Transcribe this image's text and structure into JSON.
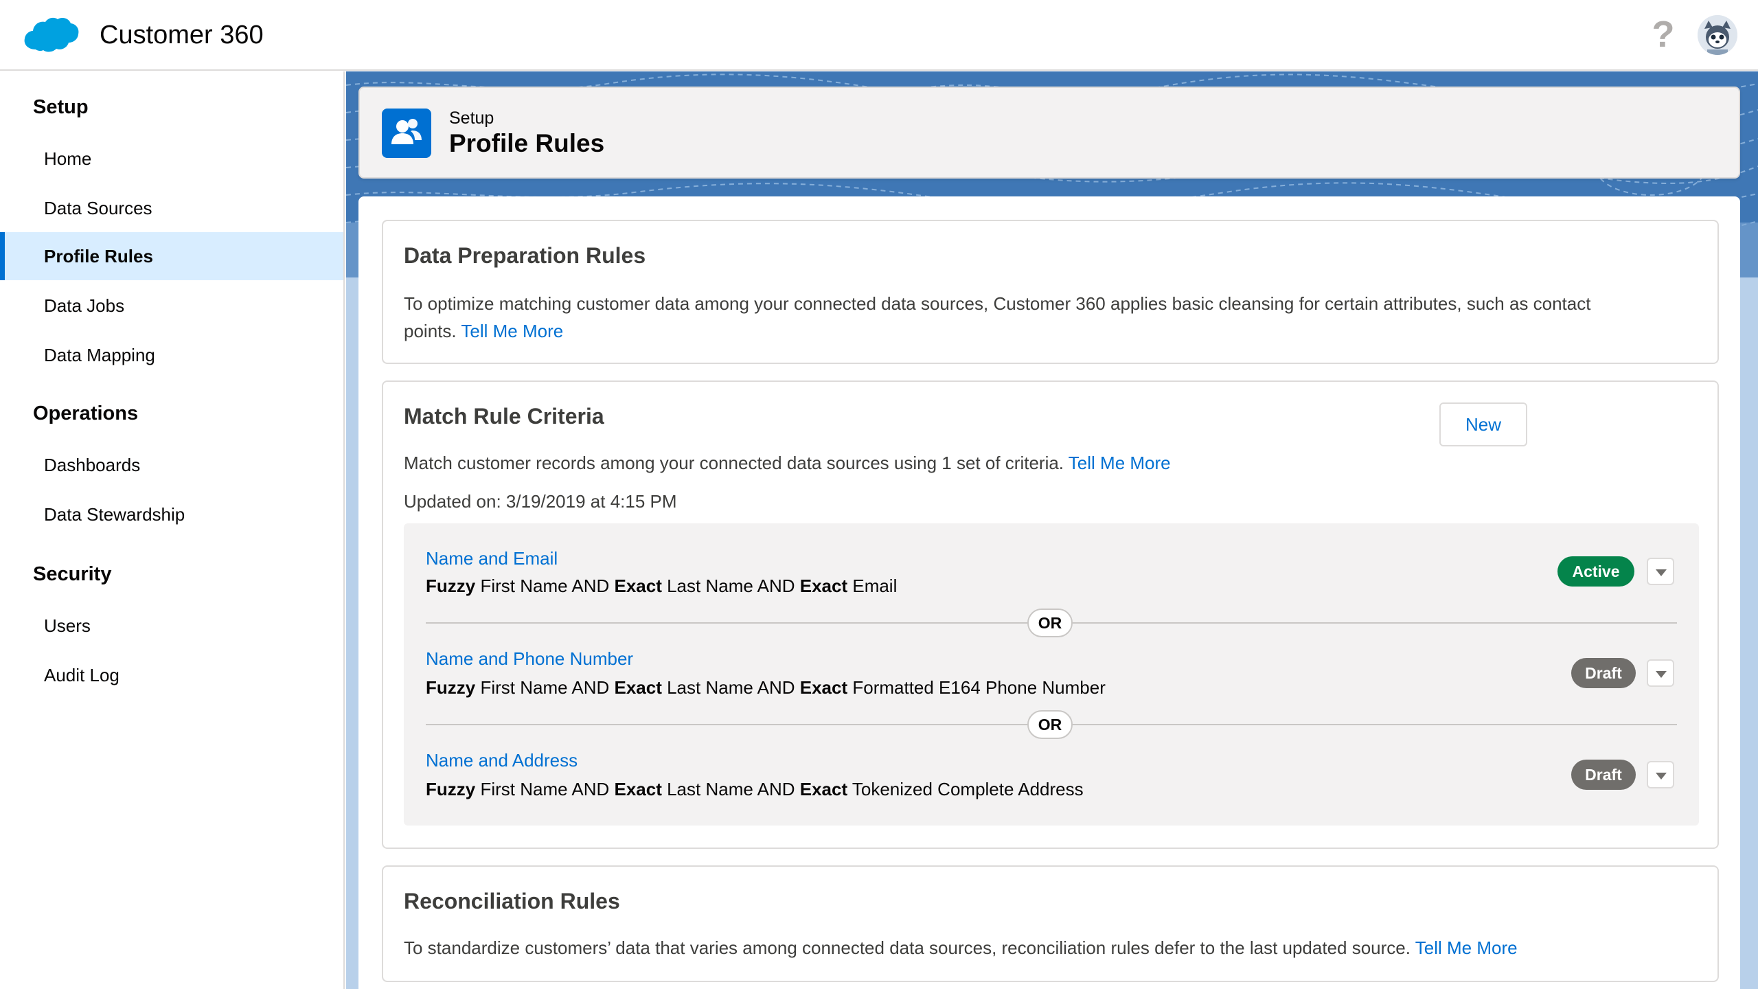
{
  "header": {
    "app_title": "Customer 360",
    "help_icon": "?",
    "logo_icon": "cloud-logo-icon",
    "avatar_icon": "astro-avatar-icon"
  },
  "sidebar": {
    "sections": [
      {
        "title": "Setup",
        "items": [
          {
            "label": "Home",
            "active": false
          },
          {
            "label": "Data Sources",
            "active": false
          },
          {
            "label": "Profile Rules",
            "active": true
          },
          {
            "label": "Data Jobs",
            "active": false
          },
          {
            "label": "Data Mapping",
            "active": false
          }
        ]
      },
      {
        "title": "Operations",
        "items": [
          {
            "label": "Dashboards",
            "active": false
          },
          {
            "label": "Data Stewardship",
            "active": false
          }
        ]
      },
      {
        "title": "Security",
        "items": [
          {
            "label": "Users",
            "active": false
          },
          {
            "label": "Audit Log",
            "active": false
          }
        ]
      }
    ]
  },
  "page_header": {
    "eyebrow": "Setup",
    "title": "Profile Rules",
    "icon": "people-icon"
  },
  "data_prep": {
    "title": "Data Preparation Rules",
    "text_line1": "To optimize matching customer data among your connected data sources, Customer 360 applies basic cleansing for certain attributes, such as contact",
    "text_line2": "points.",
    "link": "Tell Me More"
  },
  "match_rules": {
    "title": "Match Rule Criteria",
    "new_button": "New",
    "text": "Match customer records among your connected data sources using 1 set of criteria.",
    "link": "Tell Me More",
    "updated": "Updated on: 3/19/2019 at 4:15 PM",
    "or_label": "OR",
    "rules": [
      {
        "name": "Name and Email",
        "status": "Active",
        "parts": [
          {
            "bold": "Fuzzy",
            "text": " First Name AND "
          },
          {
            "bold": "Exact",
            "text": " Last Name AND "
          },
          {
            "bold": "Exact",
            "text": " Email"
          }
        ]
      },
      {
        "name": "Name and Phone Number",
        "status": "Draft",
        "parts": [
          {
            "bold": "Fuzzy",
            "text": " First Name AND "
          },
          {
            "bold": "Exact",
            "text": " Last Name AND "
          },
          {
            "bold": "Exact",
            "text": " Formatted E164 Phone Number"
          }
        ]
      },
      {
        "name": "Name and Address",
        "status": "Draft",
        "parts": [
          {
            "bold": "Fuzzy",
            "text": " First Name AND "
          },
          {
            "bold": "Exact",
            "text": " Last Name AND "
          },
          {
            "bold": "Exact",
            "text": " Tokenized Complete Address"
          }
        ]
      }
    ]
  },
  "reconciliation": {
    "title": "Reconciliation Rules",
    "text": "To standardize customers’ data that varies among connected data sources, reconciliation rules defer to the last updated source.",
    "link": "Tell Me More"
  },
  "colors": {
    "brand": "#0070d2",
    "active_badge": "#04844b",
    "draft_badge": "#706e6b",
    "nav_active_bg": "#d8edff"
  }
}
